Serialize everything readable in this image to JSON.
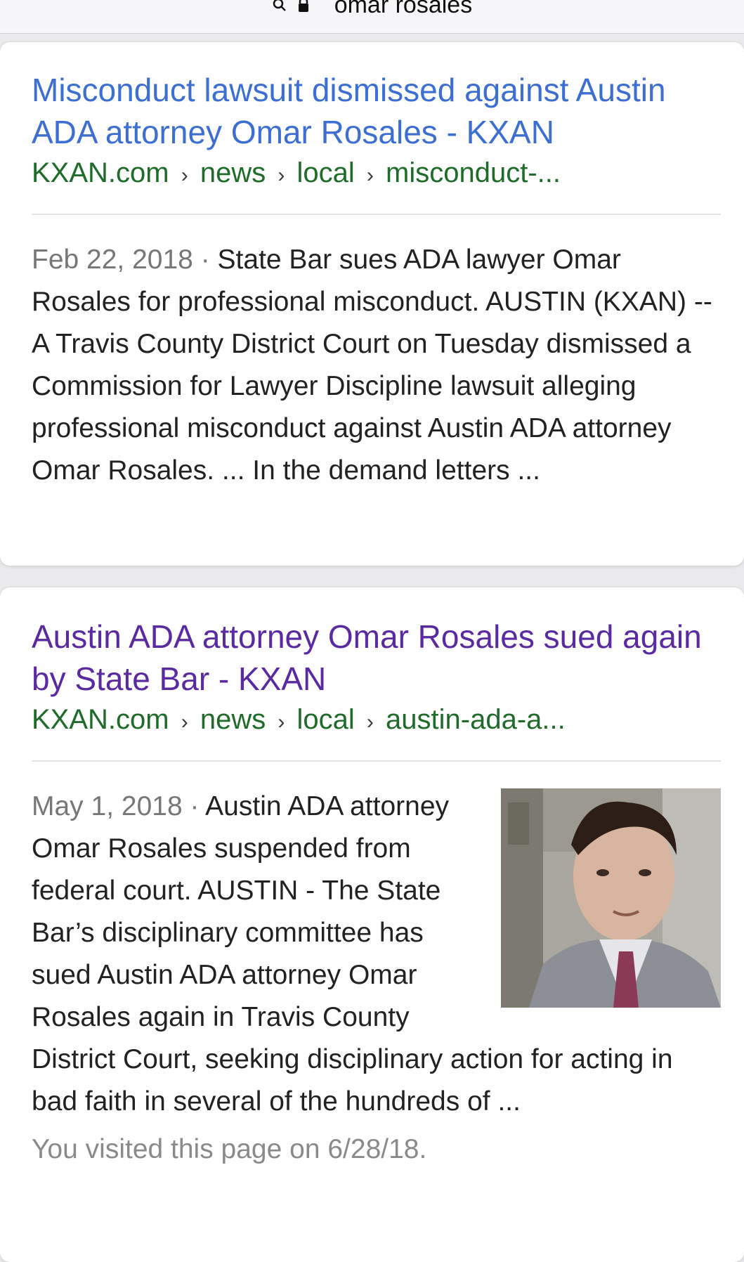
{
  "search": {
    "query": "omar rosales"
  },
  "results": [
    {
      "title": "Misconduct lawsuit dismissed against Austin ADA attorney Omar Rosales - KXAN",
      "breadcrumb": {
        "site": "KXAN.com",
        "parts": [
          "news",
          "local",
          "misconduct-..."
        ]
      },
      "date": "Feb 22, 2018",
      "separator": " · ",
      "snippet": "State Bar sues ADA lawyer Omar Rosales for professional misconduct. AUSTIN (KXAN) -- A Travis County District Court on Tuesday dismissed a Commission for Lawyer Discipline lawsuit alleging professional misconduct against Austin ADA attorney Omar Rosales. ... In the demand letters ..."
    },
    {
      "title": "Austin ADA attorney Omar Rosales sued again by State Bar - KXAN",
      "breadcrumb": {
        "site": "KXAN.com",
        "parts": [
          "news",
          "local",
          "austin-ada-a..."
        ]
      },
      "date": "May 1, 2018",
      "separator": " · ",
      "snippet": "Austin ADA attorney Omar Rosales suspended from federal court. AUSTIN - The State Bar’s disciplinary committee has sued Austin ADA attorney Omar Rosales again in Travis County District Court, seeking disciplinary action for acting in bad faith in several of the hundreds of ...",
      "visited": "You visited this page on 6/28/18."
    }
  ],
  "colors": {
    "link_unvisited": "#3c6fd1",
    "link_visited": "#5a2aa0",
    "breadcrumb": "#1f6b2a",
    "date": "#777777"
  }
}
